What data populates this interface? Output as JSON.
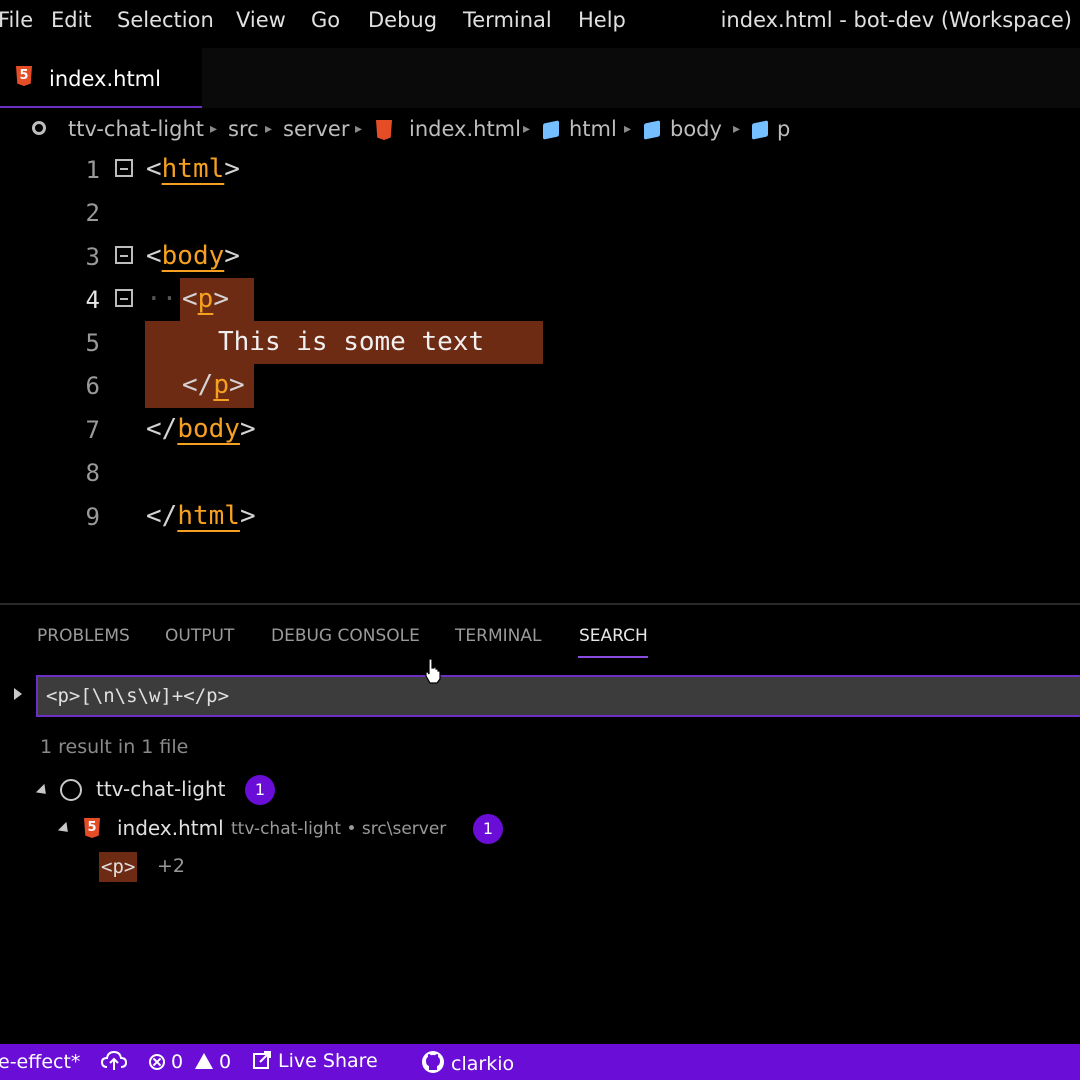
{
  "menubar": {
    "items": [
      "File",
      "Edit",
      "Selection",
      "View",
      "Go",
      "Debug",
      "Terminal",
      "Help"
    ],
    "window_title": "index.html - bot-dev (Workspace)"
  },
  "tabs": [
    {
      "label": "index.html",
      "icon": "html5-icon",
      "active": true
    }
  ],
  "breadcrumb": {
    "items": [
      "ttv-chat-light",
      "src",
      "server",
      "index.html",
      "html",
      "body",
      "p"
    ]
  },
  "editor": {
    "lines": [
      {
        "number": "1",
        "text": "<html>"
      },
      {
        "number": "2",
        "text": ""
      },
      {
        "number": "3",
        "text": "<body>"
      },
      {
        "number": "4",
        "text": "<p>"
      },
      {
        "number": "5",
        "text": "This is some text"
      },
      {
        "number": "6",
        "text": "</p>"
      },
      {
        "number": "7",
        "text": "</body>"
      },
      {
        "number": "8",
        "text": ""
      },
      {
        "number": "9",
        "text": "</html>"
      }
    ],
    "tags": {
      "html": "html",
      "body": "body",
      "p": "p"
    }
  },
  "panel": {
    "tabs": [
      "PROBLEMS",
      "OUTPUT",
      "DEBUG CONSOLE",
      "TERMINAL",
      "SEARCH"
    ],
    "active_tab": "SEARCH"
  },
  "search": {
    "query": "<p>[\\n\\s\\w]+</p>",
    "summary": "1 result in 1 file",
    "results": {
      "folder": "ttv-chat-light",
      "folder_count": "1",
      "file": "index.html",
      "file_path": "ttv-chat-light • src\\server",
      "file_count": "1",
      "match": "<p>",
      "match_extra": "+2"
    }
  },
  "statusbar": {
    "branch": "e-effect*",
    "errors": "0",
    "warnings": "0",
    "live_share": "Live Share",
    "user": "clarkio"
  },
  "colors": {
    "accent": "#6a0dd6",
    "tag": "#f5a020",
    "selection": "#6e2b14",
    "html5": "#e44d26"
  }
}
